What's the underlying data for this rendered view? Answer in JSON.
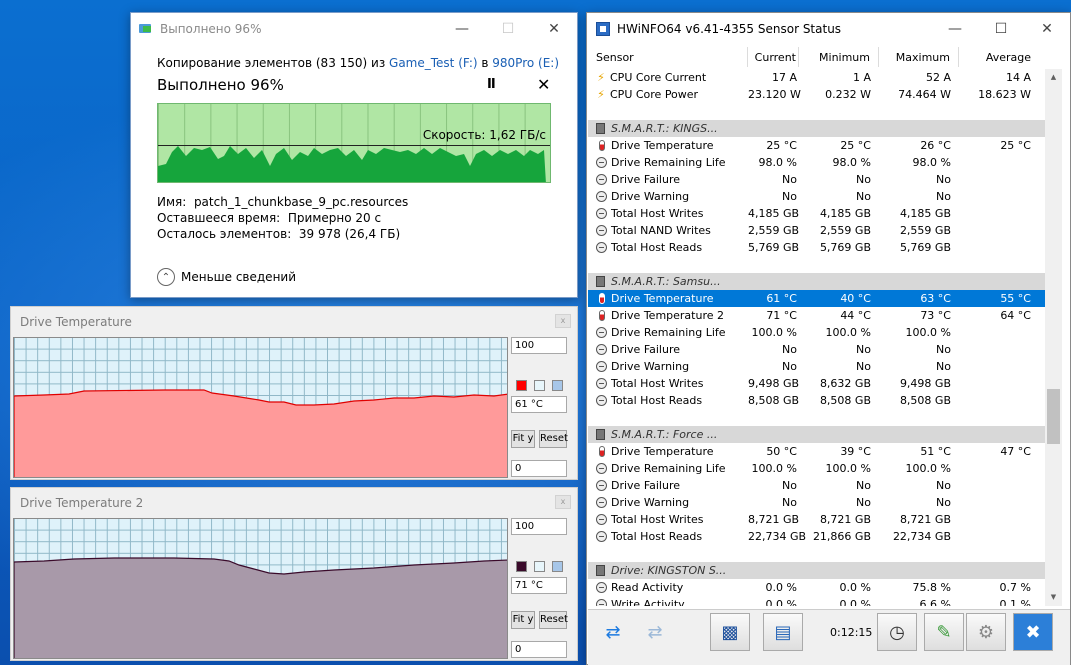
{
  "copy_dialog": {
    "title": "Выполнено 96%",
    "copy_prefix": "Копирование элементов (83 150) из ",
    "source": "Game_Test (F:)",
    "copy_mid": " в ",
    "dest": "980Pro (E:)",
    "heading": "Выполнено 96%",
    "speed": "Скорость: 1,62 ГБ/с",
    "progress_percent": 96,
    "name_label": "Имя:",
    "name_value": "patch_1_chunkbase_9_pc.resources",
    "time_label": "Оставшееся время:",
    "time_value": "Примерно 20 с",
    "items_label": "Осталось элементов:",
    "items_value": "39 978 (26,4 ГБ)",
    "less_details": "Меньше сведений",
    "pause_icon": "pause-icon",
    "stop_icon": "close-icon"
  },
  "graph1": {
    "title": "Drive Temperature",
    "max": "100",
    "current": "61 °C",
    "min": "0",
    "fit_label": "Fit y",
    "reset_label": "Reset",
    "color": "#ff0000",
    "fill": "#ff9a9a"
  },
  "graph2": {
    "title": "Drive Temperature 2",
    "max": "100",
    "current": "71 °C",
    "min": "0",
    "fit_label": "Fit y",
    "reset_label": "Reset",
    "color": "#3a0a2a",
    "fill": "#a899a9"
  },
  "hwinfo": {
    "title": "HWiNFO64 v6.41-4355 Sensor Status",
    "columns": [
      "Sensor",
      "Current",
      "Minimum",
      "Maximum",
      "Average"
    ],
    "rows": [
      {
        "t": "s",
        "icon": "bolt",
        "name": "CPU Core Current",
        "cur": "17 A",
        "min": "1 A",
        "max": "52 A",
        "avg": "14 A"
      },
      {
        "t": "s",
        "icon": "bolt",
        "name": "CPU Core Power",
        "cur": "23.120 W",
        "min": "0.232 W",
        "max": "74.464 W",
        "avg": "18.623 W"
      },
      {
        "t": "e"
      },
      {
        "t": "g",
        "name": "S.M.A.R.T.: KINGS..."
      },
      {
        "t": "s",
        "icon": "therm",
        "name": "Drive Temperature",
        "cur": "25 °C",
        "min": "25 °C",
        "max": "26 °C",
        "avg": "25 °C"
      },
      {
        "t": "s",
        "icon": "circle",
        "name": "Drive Remaining Life",
        "cur": "98.0 %",
        "min": "98.0 %",
        "max": "98.0 %",
        "avg": ""
      },
      {
        "t": "s",
        "icon": "circle",
        "name": "Drive Failure",
        "cur": "No",
        "min": "No",
        "max": "No",
        "avg": ""
      },
      {
        "t": "s",
        "icon": "circle",
        "name": "Drive Warning",
        "cur": "No",
        "min": "No",
        "max": "No",
        "avg": ""
      },
      {
        "t": "s",
        "icon": "circle",
        "name": "Total Host Writes",
        "cur": "4,185 GB",
        "min": "4,185 GB",
        "max": "4,185 GB",
        "avg": ""
      },
      {
        "t": "s",
        "icon": "circle",
        "name": "Total NAND Writes",
        "cur": "2,559 GB",
        "min": "2,559 GB",
        "max": "2,559 GB",
        "avg": ""
      },
      {
        "t": "s",
        "icon": "circle",
        "name": "Total Host Reads",
        "cur": "5,769 GB",
        "min": "5,769 GB",
        "max": "5,769 GB",
        "avg": ""
      },
      {
        "t": "e"
      },
      {
        "t": "g",
        "name": "S.M.A.R.T.: Samsu..."
      },
      {
        "t": "s",
        "icon": "therm",
        "name": "Drive Temperature",
        "cur": "61 °C",
        "min": "40 °C",
        "max": "63 °C",
        "avg": "55 °C",
        "sel": true
      },
      {
        "t": "s",
        "icon": "therm",
        "name": "Drive Temperature 2",
        "cur": "71 °C",
        "min": "44 °C",
        "max": "73 °C",
        "avg": "64 °C"
      },
      {
        "t": "s",
        "icon": "circle",
        "name": "Drive Remaining Life",
        "cur": "100.0 %",
        "min": "100.0 %",
        "max": "100.0 %",
        "avg": ""
      },
      {
        "t": "s",
        "icon": "circle",
        "name": "Drive Failure",
        "cur": "No",
        "min": "No",
        "max": "No",
        "avg": ""
      },
      {
        "t": "s",
        "icon": "circle",
        "name": "Drive Warning",
        "cur": "No",
        "min": "No",
        "max": "No",
        "avg": ""
      },
      {
        "t": "s",
        "icon": "circle",
        "name": "Total Host Writes",
        "cur": "9,498 GB",
        "min": "8,632 GB",
        "max": "9,498 GB",
        "avg": ""
      },
      {
        "t": "s",
        "icon": "circle",
        "name": "Total Host Reads",
        "cur": "8,508 GB",
        "min": "8,508 GB",
        "max": "8,508 GB",
        "avg": ""
      },
      {
        "t": "e"
      },
      {
        "t": "g",
        "name": "S.M.A.R.T.: Force ..."
      },
      {
        "t": "s",
        "icon": "therm",
        "name": "Drive Temperature",
        "cur": "50 °C",
        "min": "39 °C",
        "max": "51 °C",
        "avg": "47 °C"
      },
      {
        "t": "s",
        "icon": "circle",
        "name": "Drive Remaining Life",
        "cur": "100.0 %",
        "min": "100.0 %",
        "max": "100.0 %",
        "avg": ""
      },
      {
        "t": "s",
        "icon": "circle",
        "name": "Drive Failure",
        "cur": "No",
        "min": "No",
        "max": "No",
        "avg": ""
      },
      {
        "t": "s",
        "icon": "circle",
        "name": "Drive Warning",
        "cur": "No",
        "min": "No",
        "max": "No",
        "avg": ""
      },
      {
        "t": "s",
        "icon": "circle",
        "name": "Total Host Writes",
        "cur": "8,721 GB",
        "min": "8,721 GB",
        "max": "8,721 GB",
        "avg": ""
      },
      {
        "t": "s",
        "icon": "circle",
        "name": "Total Host Reads",
        "cur": "22,734 GB",
        "min": "21,866 GB",
        "max": "22,734 GB",
        "avg": ""
      },
      {
        "t": "e"
      },
      {
        "t": "g",
        "name": "Drive: KINGSTON S..."
      },
      {
        "t": "s",
        "icon": "circle",
        "name": "Read Activity",
        "cur": "0.0 %",
        "min": "0.0 %",
        "max": "75.8 %",
        "avg": "0.7 %"
      },
      {
        "t": "s",
        "icon": "circle",
        "name": "Write Activity",
        "cur": "0.0 %",
        "min": "0.0 %",
        "max": "6.6 %",
        "avg": "0.1 %"
      }
    ],
    "timer": "0:12:15",
    "toolbar_icons": [
      "nav-arrows-icon",
      "nav-arrows-dim-icon",
      "monitor-icon",
      "network-icon",
      "clock-icon",
      "add-report-icon",
      "gear-icon",
      "close-icon"
    ]
  }
}
